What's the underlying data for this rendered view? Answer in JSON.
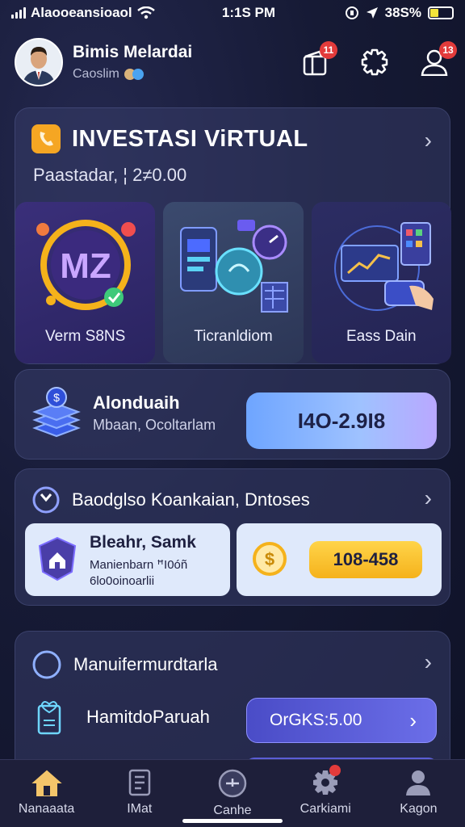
{
  "status_bar": {
    "carrier": "Alaooeansioaol",
    "time": "1:1S PM",
    "battery": "38S%",
    "battery_level": 0.4
  },
  "header": {
    "name": "Bimis Melardai",
    "subtitle": "Caoslim"
  },
  "badges": {
    "wallet": "11",
    "profile": "13"
  },
  "investasi": {
    "title": "INVESTASI ViRTUAL",
    "subtitle": "Paastadar, ¦ 2≠0.00",
    "tiles": [
      {
        "label": "Verm S8NS",
        "art_text": "MZ"
      },
      {
        "label": "Ticranldiom"
      },
      {
        "label": "Eass Dain"
      }
    ]
  },
  "balance": {
    "title": "Alonduaih",
    "subtitle": "Mbaan, Ocoltarlam",
    "value": "I4O-2.9I8"
  },
  "bonus": {
    "title": "Baodglso Koankaian, Dntoses",
    "left_title": "Bleahr, Samk",
    "left_subtitle": "Manienbarn ꟸI0óñ 6lo0oinoarlii",
    "right_value": "108-458"
  },
  "manage": {
    "title": "Manuifermurdtarla",
    "row_label": "HamitdoParuah",
    "row_button": "OrGKS:5.00"
  },
  "tabs": [
    {
      "label": "Nanaaata",
      "icon": "home-icon"
    },
    {
      "label": "IMat",
      "icon": "document-icon"
    },
    {
      "label": "Canhe",
      "icon": "compass-icon"
    },
    {
      "label": "Carkiami",
      "icon": "gear-icon"
    },
    {
      "label": "Kagon",
      "icon": "user-icon"
    }
  ],
  "colors": {
    "background": "#161a35",
    "card": "#363c68",
    "accent_blue": "#6ea5ff",
    "accent_yellow": "#ffd44a",
    "badge_red": "#e23b3b"
  }
}
